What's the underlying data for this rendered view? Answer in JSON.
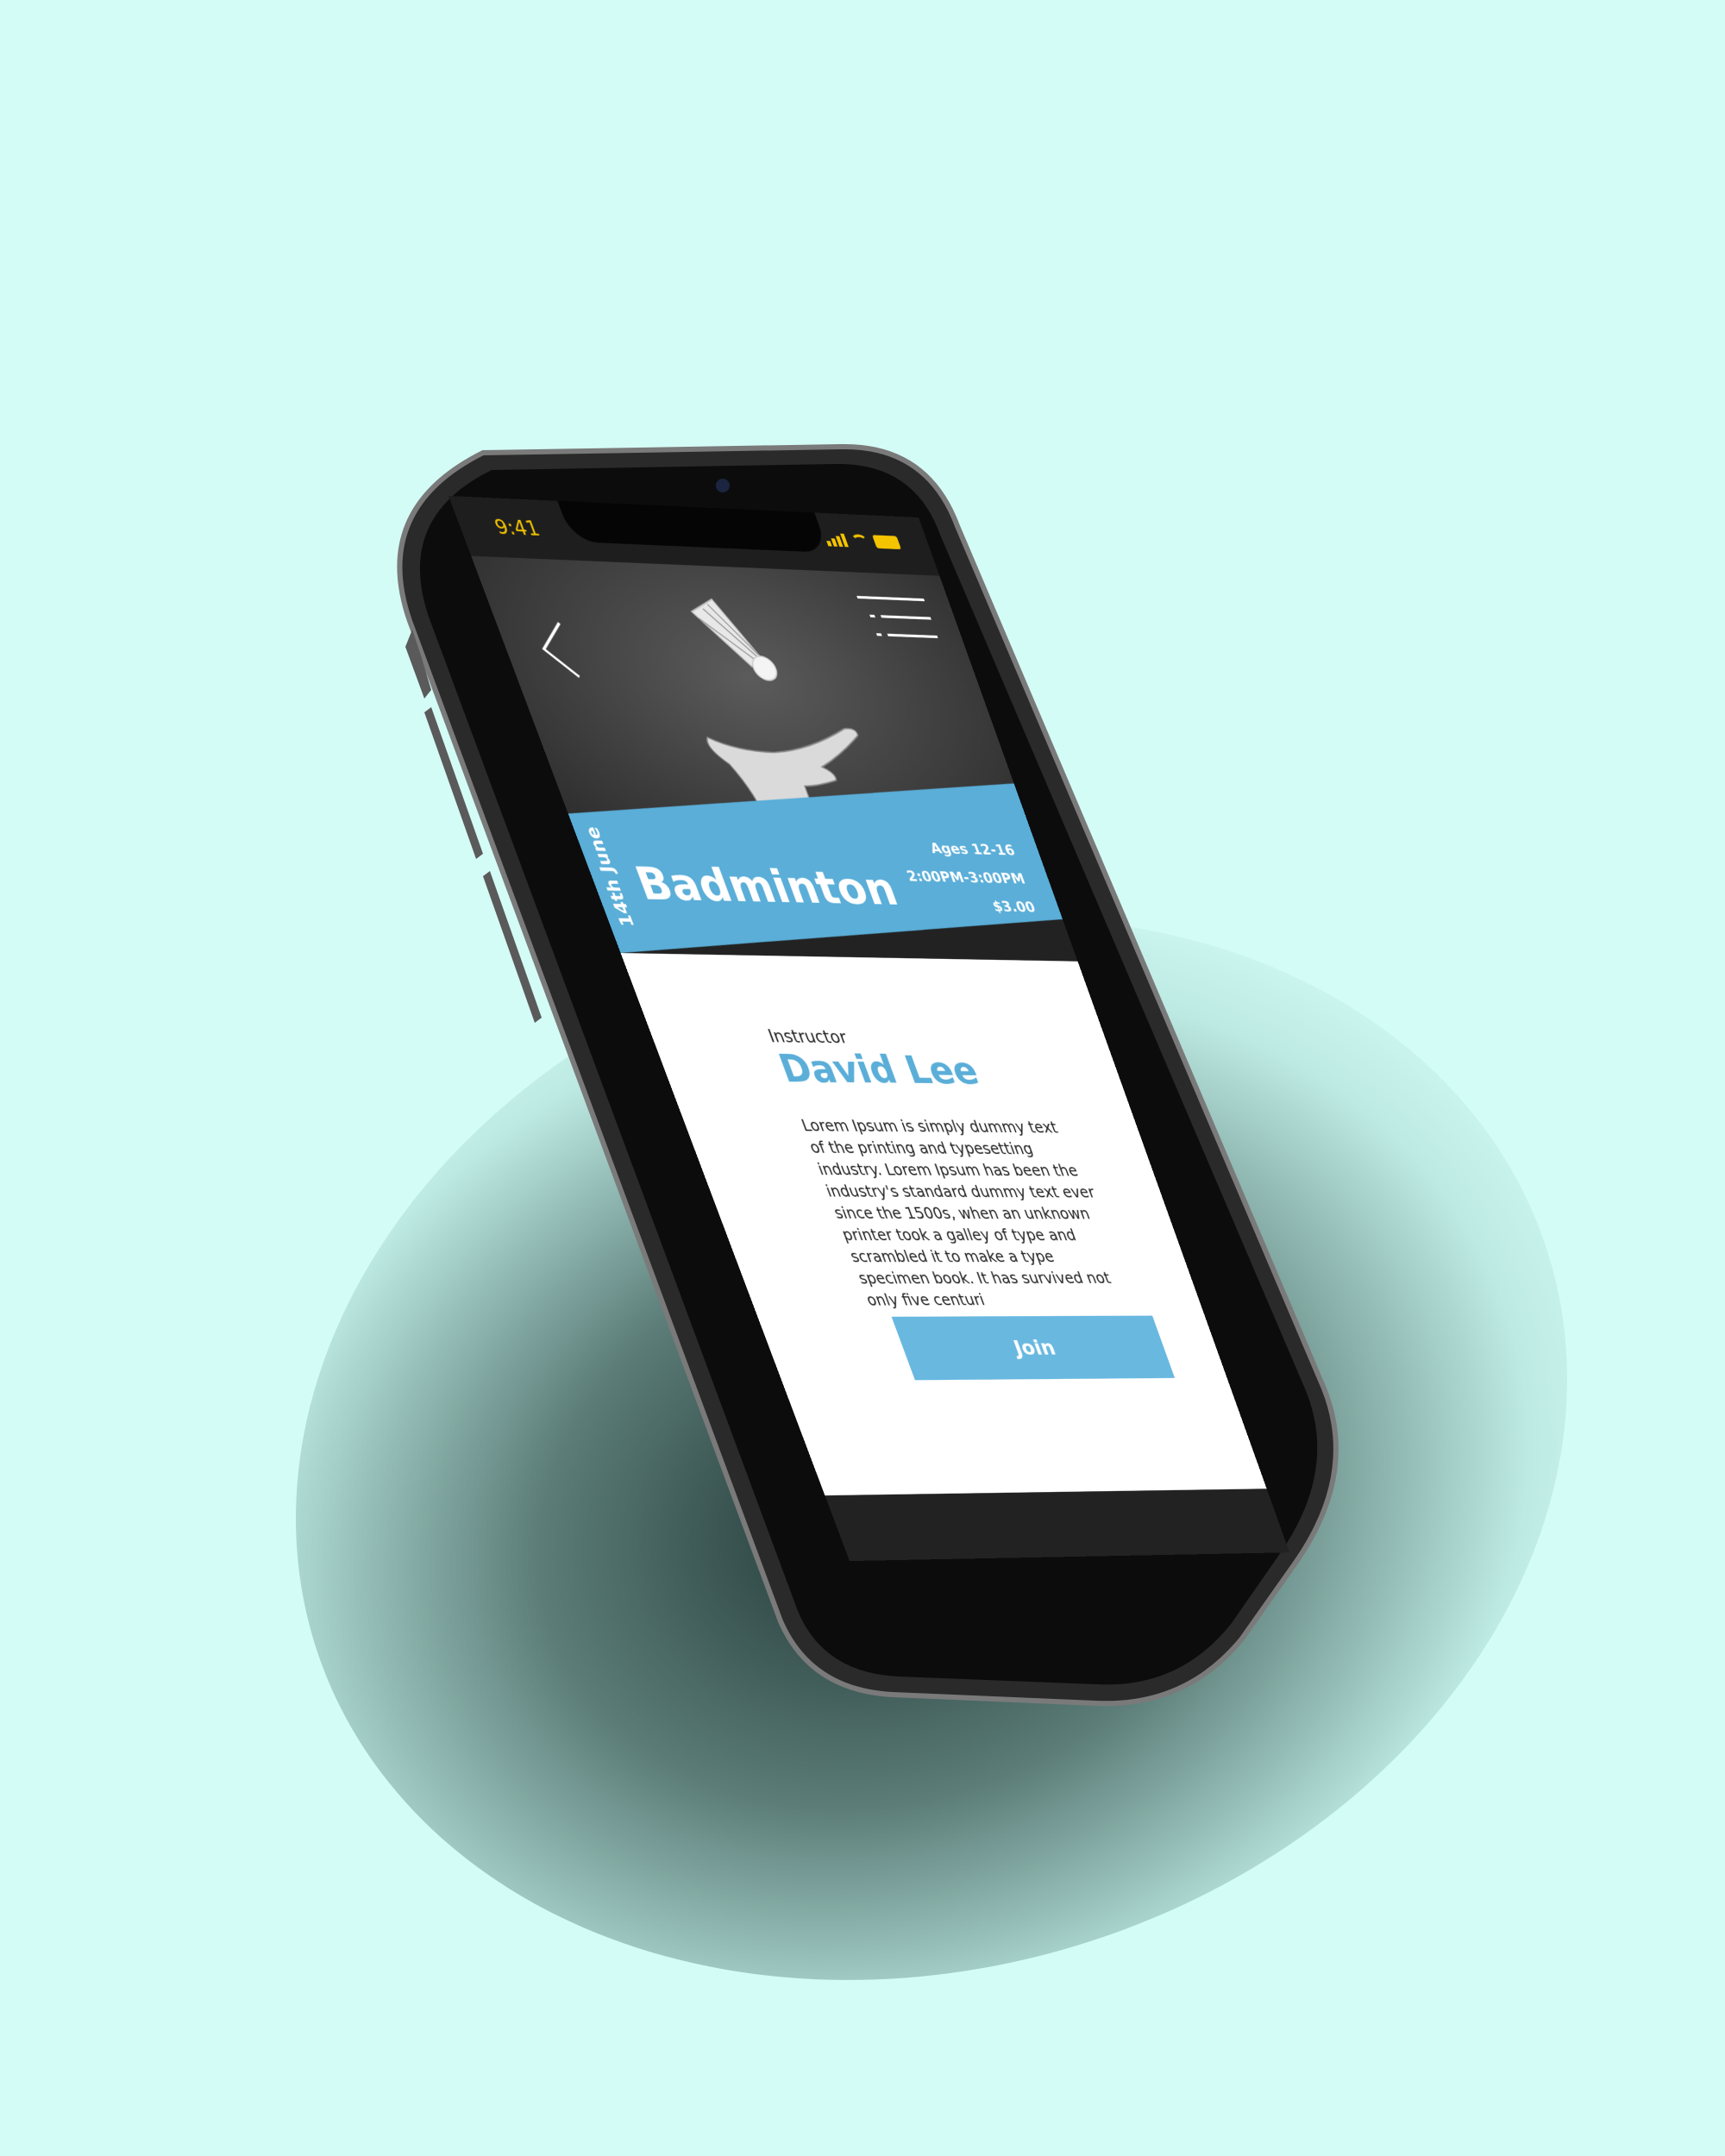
{
  "status_bar": {
    "time": "9:41",
    "icons": [
      "signal-icon",
      "wifi-icon",
      "battery-icon"
    ]
  },
  "header": {
    "back_icon": "chevron-left-icon",
    "menu_icon": "list-menu-icon",
    "hero_image": "shuttlecock-hand-photo"
  },
  "event": {
    "title": "Badminton",
    "date": "14th June",
    "ages": "Ages 12-16",
    "time": "2:00PM-3:00PM",
    "price": "$3.00"
  },
  "instructor": {
    "label": "Instructor",
    "name": "David Lee",
    "description": "Lorem Ipsum is simply dummy text of the printing and typesetting industry. Lorem Ipsum has been the industry's standard dummy text ever since the 1500s, when an unknown printer took a galley of type and scrambled it to make a type specimen book. It has survived not only five centuri"
  },
  "actions": {
    "join_label": "Join"
  },
  "colors": {
    "background": "#d4fcf6",
    "accent": "#5aaed8",
    "button": "#68b8e0",
    "status_text": "#f5c400",
    "phone_body": "#1a1a1a"
  }
}
